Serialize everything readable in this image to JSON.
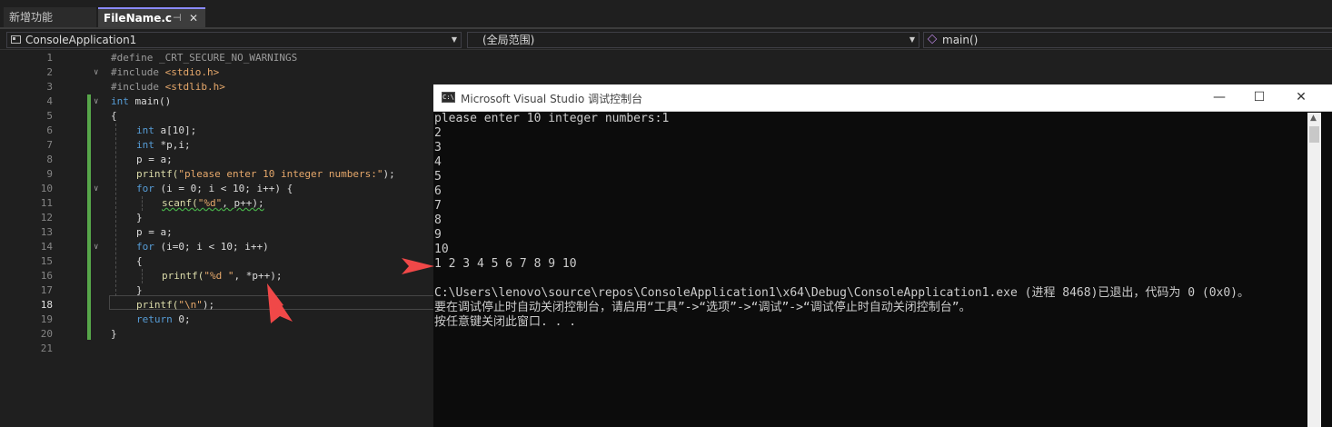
{
  "tabs": [
    {
      "label": "新增功能",
      "active": false
    },
    {
      "label": "FileName.c",
      "active": true,
      "pin": "⊣",
      "close": "✕"
    }
  ],
  "navbar": {
    "project": "ConsoleApplication1",
    "scope": "(全局范围)",
    "member": "main()"
  },
  "editor": {
    "current_line": 18,
    "lines": [
      {
        "n": "1"
      },
      {
        "n": "2"
      },
      {
        "n": "3"
      },
      {
        "n": "4"
      },
      {
        "n": "5"
      },
      {
        "n": "6"
      },
      {
        "n": "7"
      },
      {
        "n": "8"
      },
      {
        "n": "9"
      },
      {
        "n": "10"
      },
      {
        "n": "11"
      },
      {
        "n": "12"
      },
      {
        "n": "13"
      },
      {
        "n": "14"
      },
      {
        "n": "15"
      },
      {
        "n": "16"
      },
      {
        "n": "17"
      },
      {
        "n": "18"
      },
      {
        "n": "19"
      },
      {
        "n": "20"
      },
      {
        "n": "21"
      }
    ],
    "code": {
      "l1": "#define _CRT_SECURE_NO_WARNINGS",
      "l2a": "#include ",
      "l2b": "<stdio.h>",
      "l3a": "#include ",
      "l3b": "<stdlib.h>",
      "l4a": "int",
      "l4b": " main()",
      "l5": "{",
      "l6a": "int",
      "l6b": " a[10];",
      "l7a": "int",
      "l7b": " *p,i;",
      "l8": "p = a;",
      "l9a": "printf(",
      "l9b": "\"please enter 10 integer numbers:\"",
      "l9c": ");",
      "l10a": "for",
      "l10b": " (i = 0; i < 10; i++) {",
      "l11a": "scanf(",
      "l11b": "\"%d\"",
      "l11c": ", p++);",
      "l12": "}",
      "l13": "p = a;",
      "l14a": "for",
      "l14b": " (i=0; i < 10; i++)",
      "l15": "{",
      "l16a": "printf(",
      "l16b": "\"%d \"",
      "l16c": ", *p++);",
      "l17": "}",
      "l18a": "printf(",
      "l18b": "\"\\n\"",
      "l18c": ");",
      "l19a": "return",
      "l19b": " 0;",
      "l20": "}"
    }
  },
  "console": {
    "title": "Microsoft Visual Studio 调试控制台",
    "icon_text": "C:\\",
    "min": "—",
    "max": "☐",
    "close": "✕",
    "output": "please enter 10 integer numbers:1\n2\n3\n4\n5\n6\n7\n8\n9\n10\n1 2 3 4 5 6 7 8 9 10\n\nC:\\Users\\lenovo\\source\\repos\\ConsoleApplication1\\x64\\Debug\\ConsoleApplication1.exe (进程 8468)已退出，代码为 0 (0x0)。\n要在调试停止时自动关闭控制台，请启用“工具”->“选项”->“调试”->“调试停止时自动关闭控制台”。\n按任意键关闭此窗口. . ."
  },
  "colors": {
    "annotation_arrow": "#f04848",
    "change_bar": "#57a64a",
    "keyword": "#569cd6",
    "string": "#e6a86b"
  }
}
